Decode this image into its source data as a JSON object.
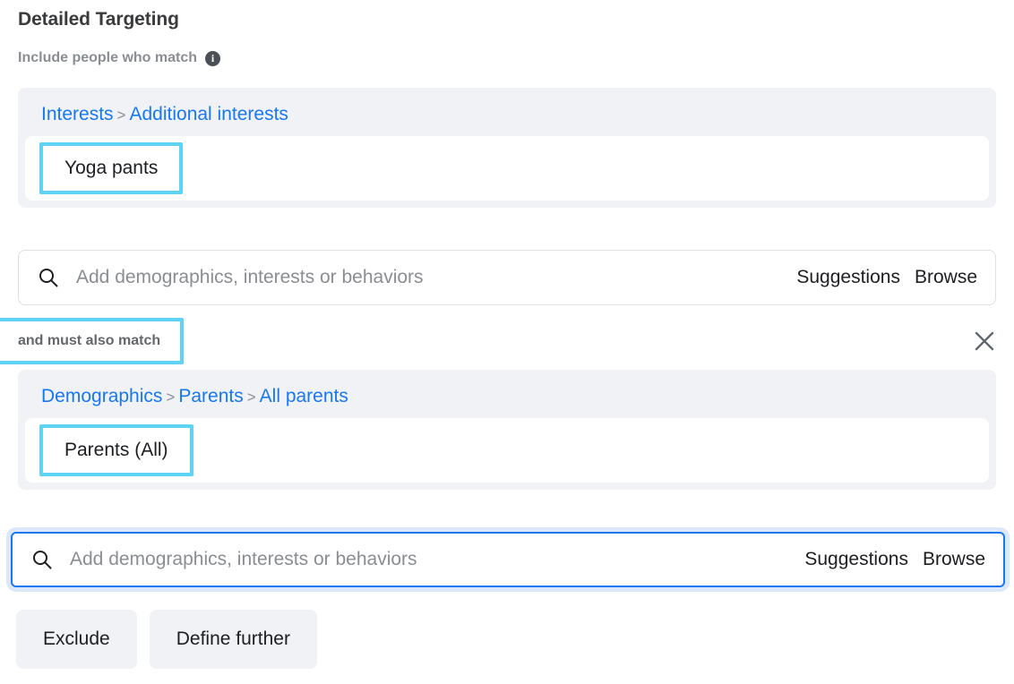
{
  "header": {
    "title": "Detailed Targeting",
    "subtitle": "Include people who match",
    "info_icon": "info-icon"
  },
  "colors": {
    "link_blue": "#1877f2",
    "highlight_cyan": "#5ed3f3",
    "focus_blue": "#1877f2",
    "panel_gray": "#f0f2f5",
    "muted_text": "#8a8d91"
  },
  "groups": [
    {
      "breadcrumb": [
        "Interests",
        "Additional interests"
      ],
      "separator": ">",
      "chips": [
        "Yoga pants"
      ],
      "search": {
        "icon": "search-icon",
        "placeholder": "Add demographics, interests or behaviors",
        "suggestions_label": "Suggestions",
        "browse_label": "Browse",
        "focused": false
      }
    },
    {
      "breadcrumb": [
        "Demographics",
        "Parents",
        "All parents"
      ],
      "separator": ">",
      "chips": [
        "Parents (All)"
      ],
      "search": {
        "icon": "search-icon",
        "placeholder": "Add demographics, interests or behaviors",
        "suggestions_label": "Suggestions",
        "browse_label": "Browse",
        "focused": true
      }
    }
  ],
  "narrow": {
    "label": "and must also match",
    "close_icon": "close-icon"
  },
  "footer": {
    "exclude_label": "Exclude",
    "define_further_label": "Define further"
  }
}
